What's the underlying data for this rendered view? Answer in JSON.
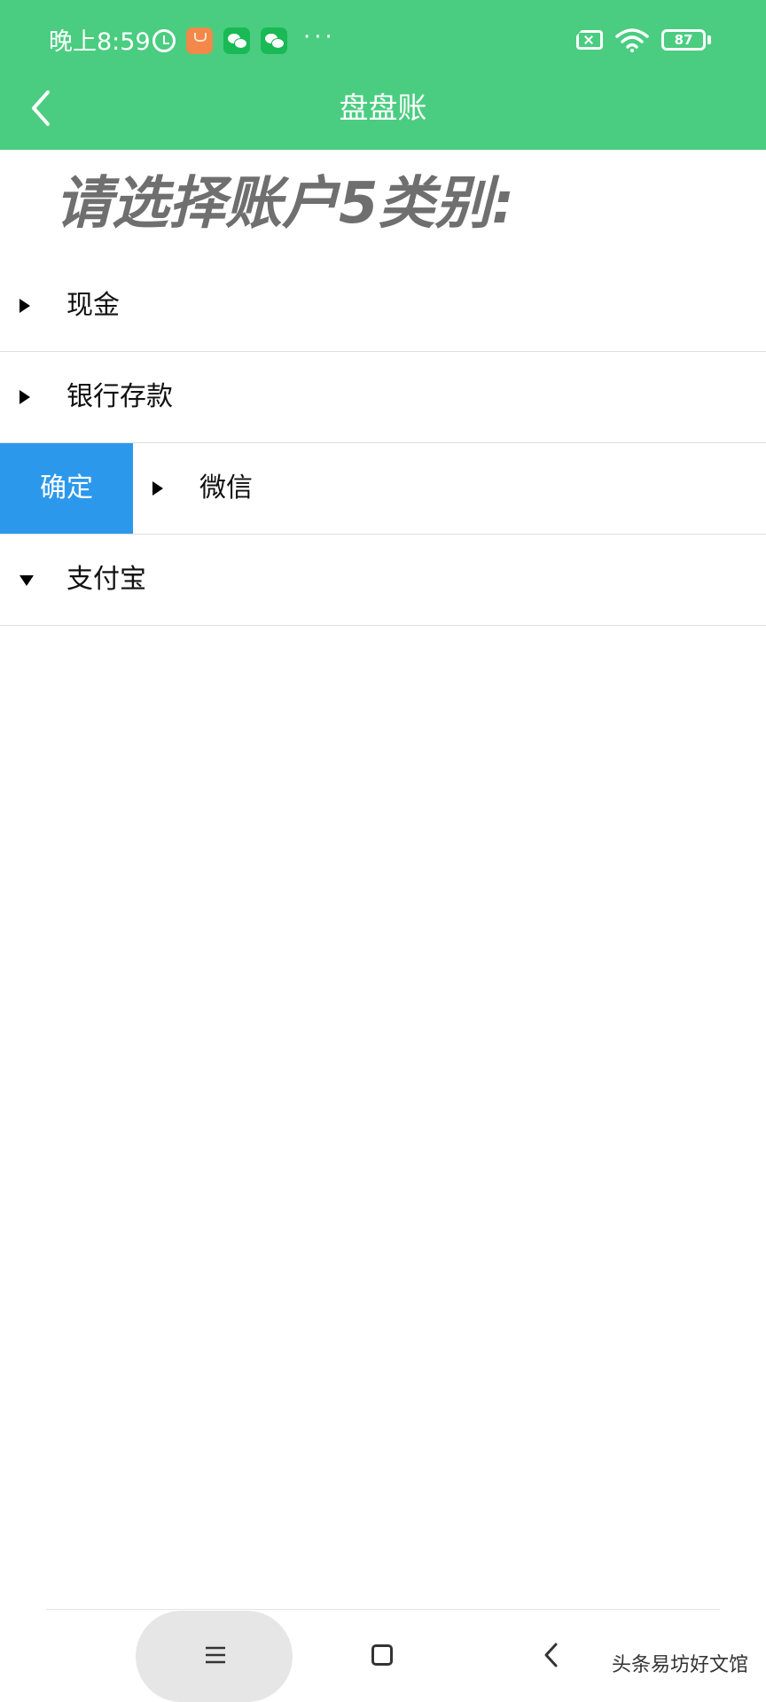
{
  "status_bar": {
    "time": "晚上8:59",
    "battery": "87",
    "more": "···"
  },
  "header": {
    "title": "盘盘账",
    "color": "#4ACD80"
  },
  "prompt": "请选择账户5类别:",
  "accounts": [
    {
      "label": "现金",
      "expanded": false
    },
    {
      "label": "银行存款",
      "expanded": false
    },
    {
      "label": "微信",
      "expanded": false,
      "action": "确定"
    },
    {
      "label": "支付宝",
      "expanded": true
    }
  ],
  "action_color": "#2C98EC",
  "watermark": "头条易坊好文馆"
}
